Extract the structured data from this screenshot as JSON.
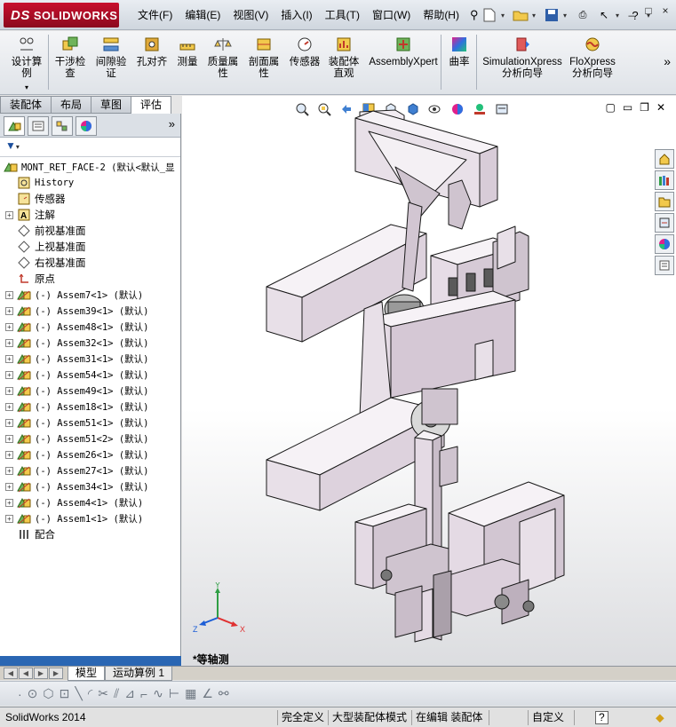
{
  "title_bar": {
    "logo_text": "SOLIDWORKS",
    "logo_prefix": "DS",
    "menu": [
      "文件(F)",
      "编辑(E)",
      "视图(V)",
      "插入(I)",
      "工具(T)",
      "窗口(W)",
      "帮助(H)"
    ],
    "window_controls": [
      "?",
      "_",
      "□",
      "×"
    ]
  },
  "command_manager": {
    "items": [
      {
        "label": "设计算\n例",
        "icon": "design-study-icon"
      },
      {
        "label": "干涉检\n查",
        "icon": "interference-icon"
      },
      {
        "label": "间隙验\n证",
        "icon": "clearance-icon"
      },
      {
        "label": "孔对齐",
        "icon": "hole-align-icon"
      },
      {
        "label": "测量",
        "icon": "measure-icon"
      },
      {
        "label": "质量属\n性",
        "icon": "mass-props-icon"
      },
      {
        "label": "剖面属\n性",
        "icon": "section-props-icon"
      },
      {
        "label": "传感器",
        "icon": "sensor-icon"
      },
      {
        "label": "装配体\n直观",
        "icon": "assembly-visualization-icon"
      },
      {
        "label": "AssemblyXpert",
        "icon": "assemblyxpert-icon"
      },
      {
        "label": "曲率",
        "icon": "curvature-icon"
      },
      {
        "label": "SimulationXpress\n分析向导",
        "icon": "simulationxpress-icon"
      },
      {
        "label": "FloXpress\n分析向导",
        "icon": "floxpress-icon"
      }
    ],
    "overflow": "»",
    "tabs": [
      "装配体",
      "布局",
      "草图",
      "评估"
    ],
    "active_tab": "评估"
  },
  "feature_tree": {
    "root": "MONT_RET_FACE-2  (默认<默认_显",
    "items": [
      {
        "label": "History",
        "icon": "history-icon",
        "expandable": false
      },
      {
        "label": "传感器",
        "icon": "sensor-folder-icon",
        "expandable": false
      },
      {
        "label": "注解",
        "icon": "annotation-icon",
        "expandable": true
      },
      {
        "label": "前视基准面",
        "icon": "plane-icon",
        "expandable": false
      },
      {
        "label": "上视基准面",
        "icon": "plane-icon",
        "expandable": false
      },
      {
        "label": "右视基准面",
        "icon": "plane-icon",
        "expandable": false
      },
      {
        "label": "原点",
        "icon": "origin-icon",
        "expandable": false
      }
    ],
    "components": [
      "(-) Assem7<1> (默认)",
      "(-) Assem39<1> (默认)",
      "(-) Assem48<1> (默认)",
      "(-) Assem32<1> (默认)",
      "(-) Assem31<1> (默认)",
      "(-) Assem54<1> (默认)",
      "(-) Assem49<1> (默认)",
      "(-) Assem18<1> (默认)",
      "(-) Assem51<1> (默认)",
      "(-) Assem51<2> (默认)",
      "(-) Assem26<1> (默认)",
      "(-) Assem27<1> (默认)",
      "(-) Assem34<1> (默认)",
      "(-) Assem4<1> (默认)",
      "(-) Assem1<1> (默认)"
    ],
    "mates": "配合",
    "more": "»"
  },
  "viewport": {
    "view_label": "*等轴测",
    "triad_axes": [
      "Y",
      "X",
      "Z"
    ]
  },
  "model_tabs": [
    "模型",
    "运动算例 1"
  ],
  "active_model_tab": "模型",
  "status_bar": {
    "app": "SolidWorks 2014",
    "state": "完全定义",
    "mode": "大型装配体模式",
    "editing": "在编辑 装配体",
    "units": "自定义",
    "help": "?"
  },
  "colors": {
    "accent": "#2a66b3",
    "logo_red": "#c8102e",
    "model_face": "#e9e1ea"
  }
}
